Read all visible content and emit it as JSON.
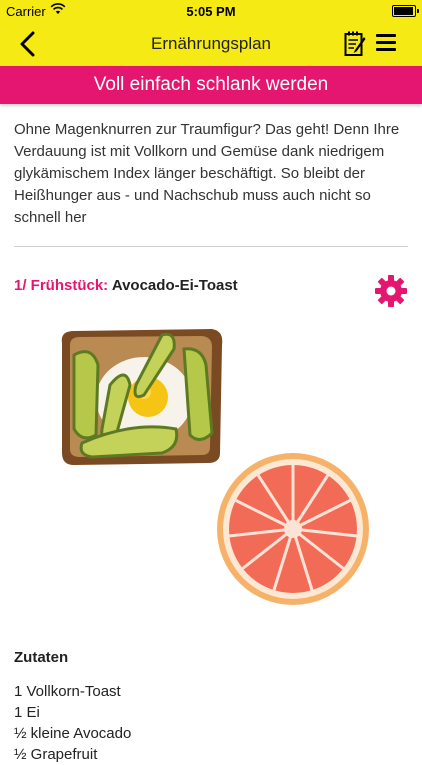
{
  "status": {
    "carrier": "Carrier",
    "time": "5:05 PM"
  },
  "navbar": {
    "title": "Ernährungsplan",
    "back_icon": "chevron-left-icon",
    "note_icon": "notepad-icon",
    "menu_icon": "hamburger-menu-icon"
  },
  "banner": {
    "text": "Voll einfach schlank werden"
  },
  "intro": {
    "text": "Ohne Magenknurren zur Traumfigur? Das geht! Denn Ihre Verdauung ist mit Vollkorn und Gemüse dank niedrigem glykämischem Index länger beschäftigt. So bleibt der Heißhunger aus - und Nachschub muss auch nicht so schnell her"
  },
  "meal": {
    "label": "1/ Frühstück:",
    "name": "Avocado-Ei-Toast"
  },
  "ingredients": {
    "heading": "Zutaten",
    "items": [
      "1 Vollkorn-Toast",
      "1 Ei",
      "½ kleine Avocado",
      "½ Grapefruit"
    ]
  },
  "colors": {
    "accent_yellow": "#f5ea14",
    "accent_pink": "#e4166f"
  }
}
